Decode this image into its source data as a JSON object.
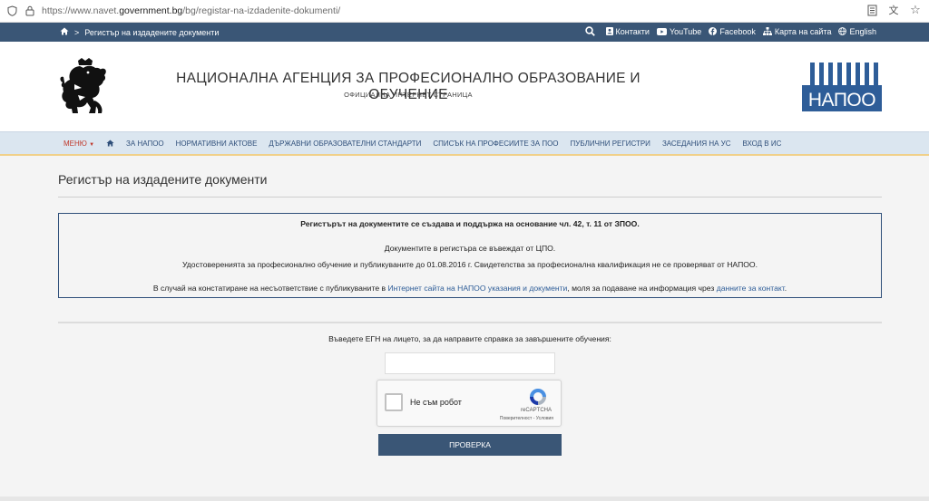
{
  "browser": {
    "url_prefix": "https://www.navet.",
    "url_domain": "government.bg",
    "url_path": "/bg/registar-na-izdadenite-dokumenti/"
  },
  "topbar": {
    "breadcrumb": "Регистър на издадените документи",
    "links": {
      "contacts": "Контакти",
      "youtube": "YouTube",
      "facebook": "Facebook",
      "sitemap": "Карта на сайта",
      "english": "English"
    }
  },
  "header": {
    "title": "НАЦИОНАЛНА АГЕНЦИЯ ЗА ПРОФЕСИОНАЛНО ОБРАЗОВАНИЕ И ОБУЧЕНИЕ",
    "subtitle": "ОФИЦИАЛНА ИНТЕРНЕТ СТРАНИЦА",
    "logo_text": "НАПОО"
  },
  "nav": {
    "menu": "МЕНЮ",
    "items": [
      "ЗА НАПОО",
      "НОРМАТИВНИ АКТОВЕ",
      "ДЪРЖАВНИ ОБРАЗОВАТЕЛНИ СТАНДАРТИ",
      "СПИСЪК НА ПРОФЕСИИТЕ ЗА ПОО",
      "ПУБЛИЧНИ РЕГИСТРИ",
      "ЗАСЕДАНИЯ НА УС",
      "ВХОД В ИС"
    ]
  },
  "page": {
    "title": "Регистър на издадените документи"
  },
  "info": {
    "line1": "Регистърът на документите се създава и поддържа на основание чл. 42,  т. 11 от ЗПОО.",
    "line2": "Документите в регистъра се въвеждат от ЦПО.",
    "line3": "Удостоверенията за професионално обучение и публикуваните до 01.08.2016 г. Свидетелства за професионална квалификация не се проверяват от НАПОО.",
    "line4_a": "В случай на констатиране на несъответствие с публикуваните в ",
    "line4_link1": "Интернет сайта на НАПОО указания и документи",
    "line4_b": ", моля за подаване на информация чрез ",
    "line4_link2": "данните за контакт",
    "line4_c": "."
  },
  "form": {
    "label": "Въведете ЕГН на лицето, за да направите справка за завършените обучения:",
    "egn_value": "",
    "captcha_label": "Не съм робот",
    "captcha_brand": "reCAPTCHA",
    "captcha_terms": "Поверителност - Условия",
    "submit": "ПРОВЕРКА"
  },
  "colors": {
    "primary": "#3a5676",
    "nav_bg": "#dbe6f0",
    "accent_gold": "#f0d089",
    "menu_red": "#c0392b"
  }
}
